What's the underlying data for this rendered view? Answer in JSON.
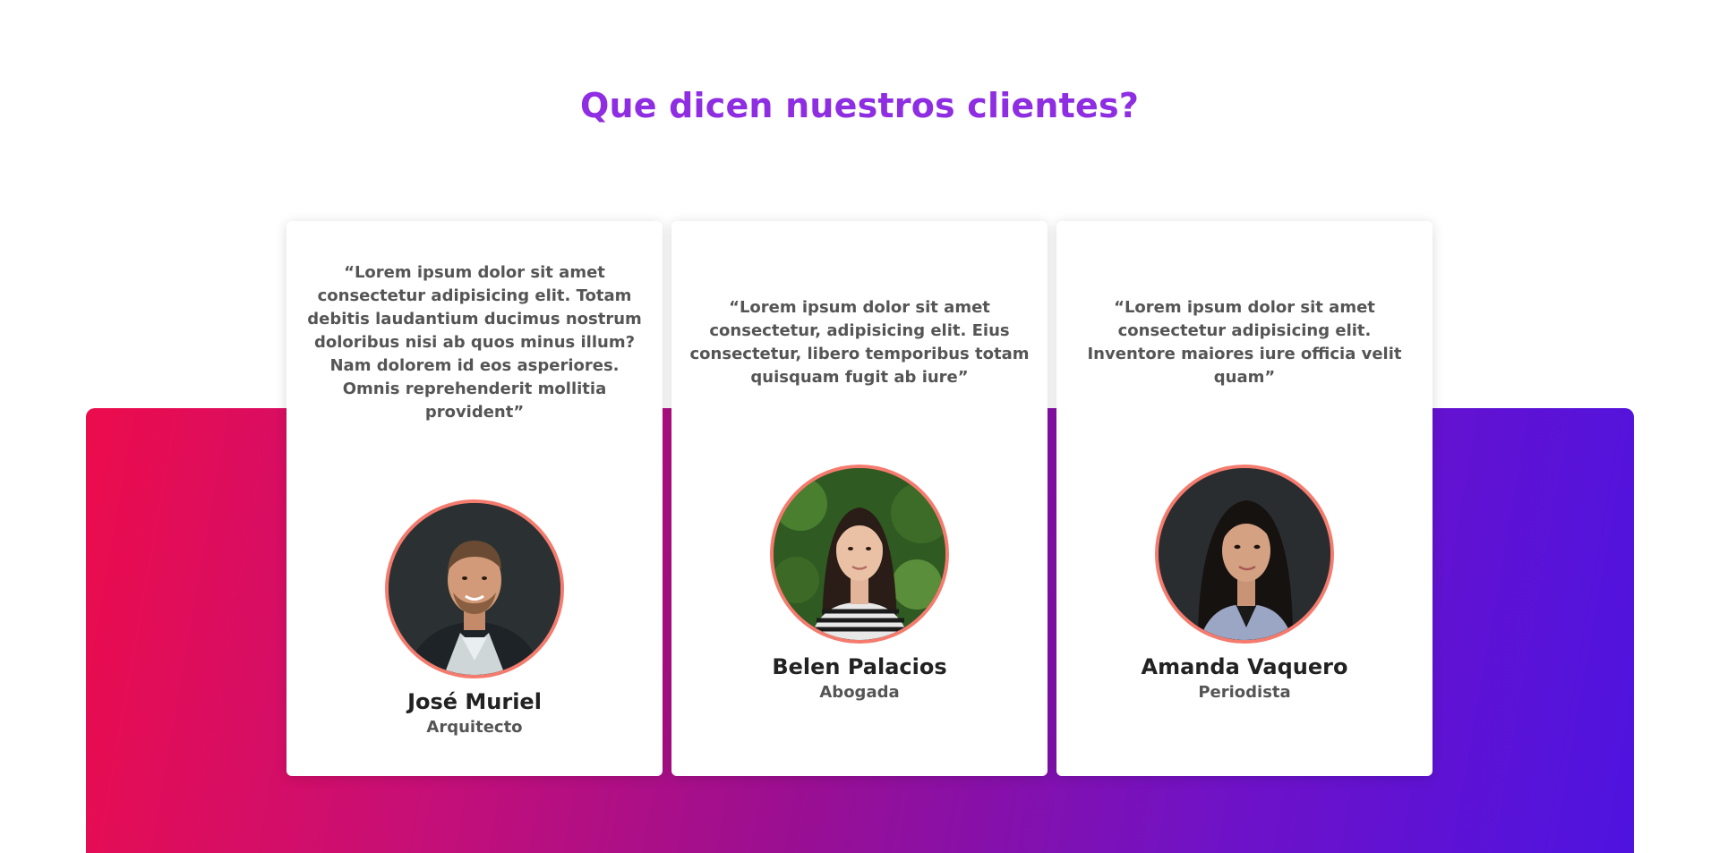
{
  "section": {
    "title": "Que dicen nuestros clientes?"
  },
  "colors": {
    "title": "#8e2de2",
    "avatar_border": "#f47b6e",
    "gradient_start": "#ec0c4c",
    "gradient_end": "#4e13e0"
  },
  "testimonials": [
    {
      "quote": "“Lorem ipsum dolor sit amet consectetur adipisicing elit. Totam debitis laudantium ducimus nostrum doloribus nisi ab quos minus illum? Nam dolorem id eos asperiores. Omnis reprehenderit mollitia provident”",
      "name": "José Muriel",
      "role": "Arquitecto",
      "avatar": "man-portrait-photo"
    },
    {
      "quote": "“Lorem ipsum dolor sit amet consectetur, adipisicing elit. Eius consectetur, libero temporibus totam quisquam fugit ab iure”",
      "name": "Belen Palacios",
      "role": "Abogada",
      "avatar": "woman-portrait-photo"
    },
    {
      "quote": "“Lorem ipsum dolor sit amet consectetur adipisicing elit. Inventore maiores iure officia velit quam”",
      "name": "Amanda Vaquero",
      "role": "Periodista",
      "avatar": "woman-portrait-photo"
    }
  ]
}
